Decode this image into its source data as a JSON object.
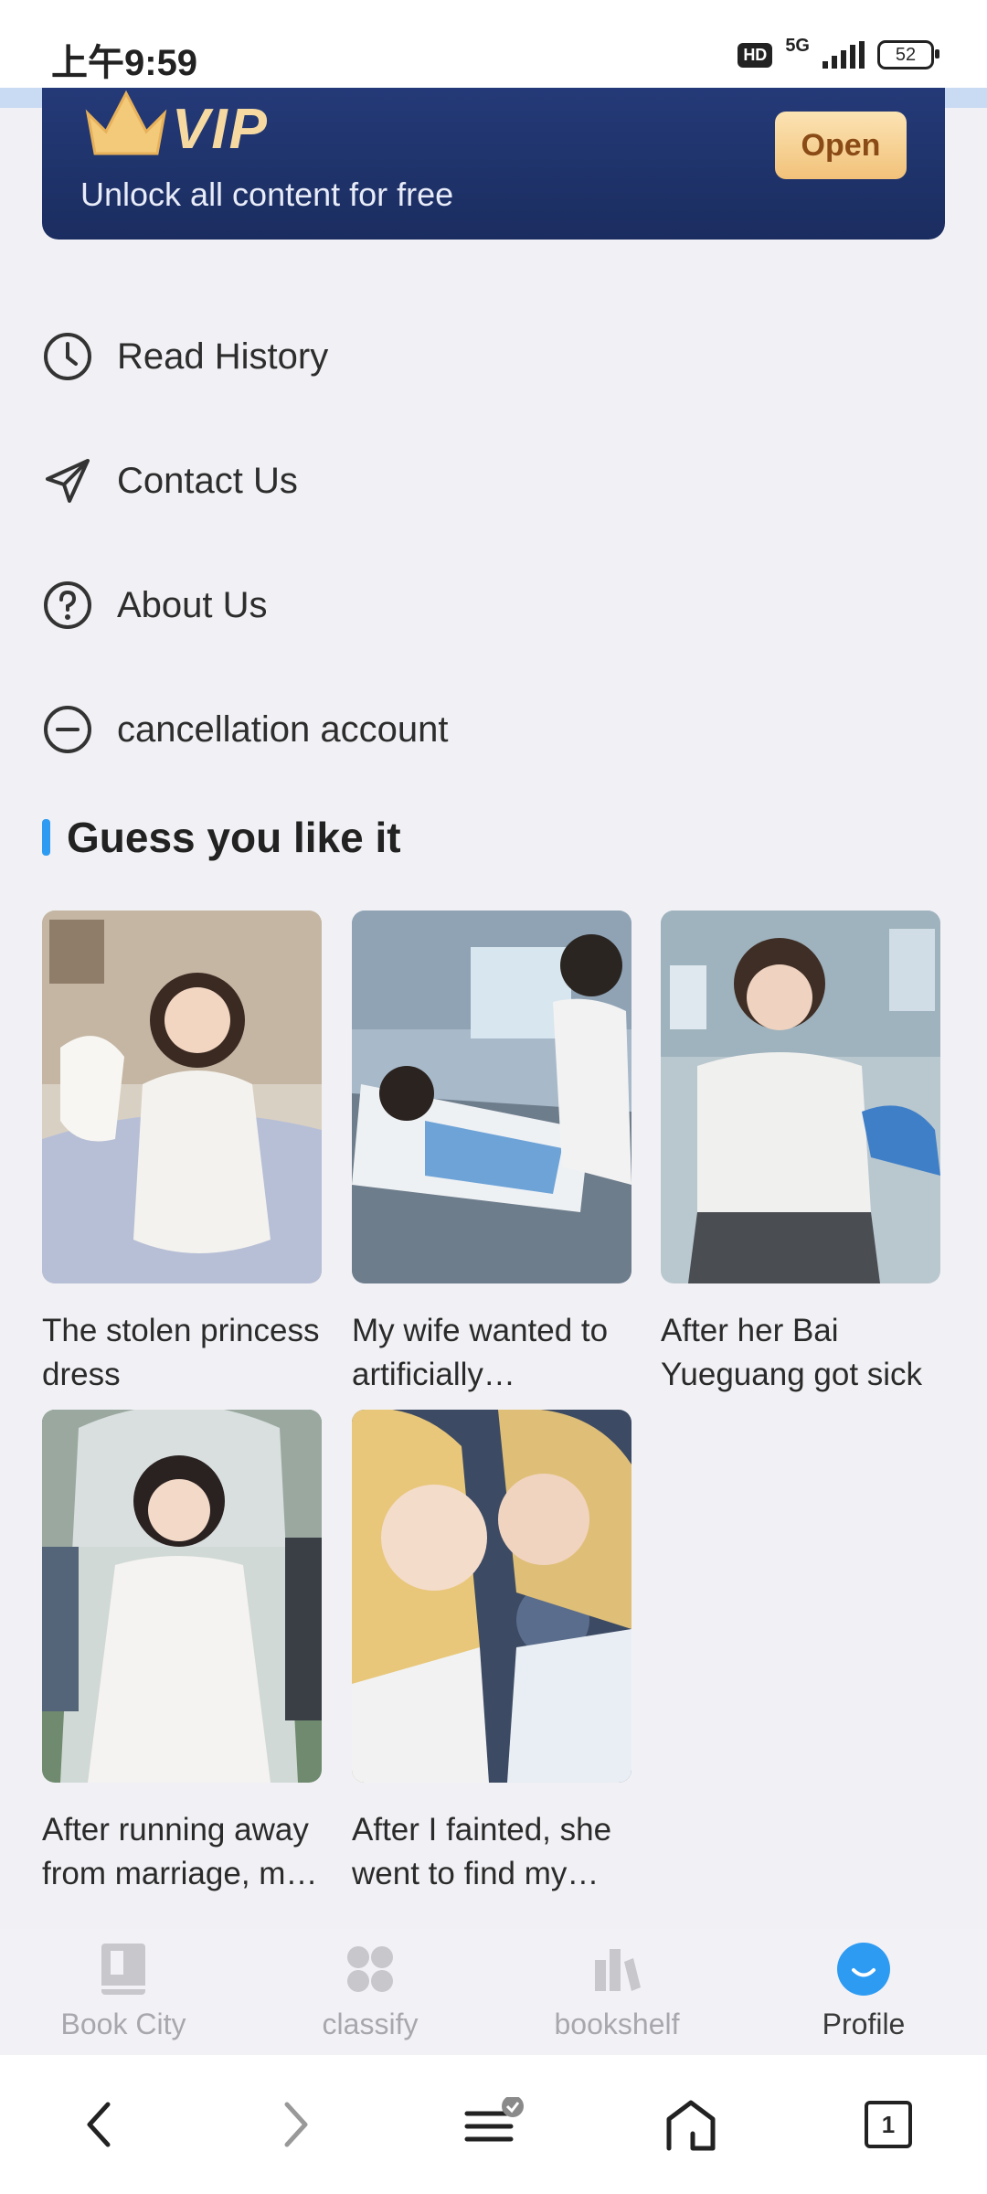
{
  "status": {
    "time": "上午9:59",
    "hd": "HD",
    "network": "5G",
    "battery": "52"
  },
  "vip": {
    "title": "VIP",
    "subtitle": "Unlock all content for free",
    "open_label": "Open"
  },
  "menu": [
    {
      "label": "Read History",
      "icon": "clock-icon"
    },
    {
      "label": "Contact Us",
      "icon": "paper-plane-icon"
    },
    {
      "label": "About Us",
      "icon": "question-circle-icon"
    },
    {
      "label": "cancellation account",
      "icon": "minus-circle-icon"
    }
  ],
  "section": {
    "title": "Guess you like it"
  },
  "books": [
    {
      "title": "The stolen princess dress"
    },
    {
      "title": "My wife wanted to artificially inseminate"
    },
    {
      "title": "After her Bai Yueguang got sick"
    },
    {
      "title": "After running away from marriage, my husband"
    },
    {
      "title": "After I fainted, she went to find my brother"
    }
  ],
  "tabs": [
    {
      "label": "Book City",
      "icon": "book-icon",
      "active": false
    },
    {
      "label": "classify",
      "icon": "grid-icon",
      "active": false
    },
    {
      "label": "bookshelf",
      "icon": "bookshelf-icon",
      "active": false
    },
    {
      "label": "Profile",
      "icon": "profile-icon",
      "active": true
    }
  ],
  "browser": {
    "tab_count": "1"
  },
  "colors": {
    "accent": "#2e9bf2",
    "vip_bg": "#1f3268",
    "vip_gold": "#f5d9a1"
  }
}
